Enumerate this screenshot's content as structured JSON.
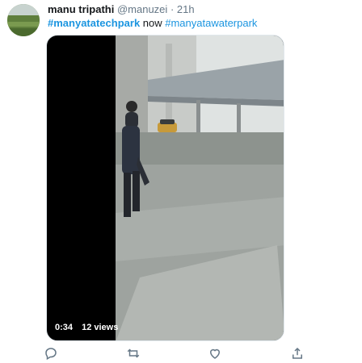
{
  "tweet": {
    "author": {
      "display_name": "manu tripathi",
      "handle": "@manuzei",
      "separator": "·",
      "time": "21h"
    },
    "text": {
      "hashtag_1": "#manyatatechpark",
      "middle": " now ",
      "hashtag_2": "#manyatawaterpark"
    },
    "video": {
      "duration": "0:34",
      "views": "12 views"
    },
    "actions": [
      "reply-icon",
      "retweet-icon",
      "like-icon",
      "share-icon"
    ]
  }
}
